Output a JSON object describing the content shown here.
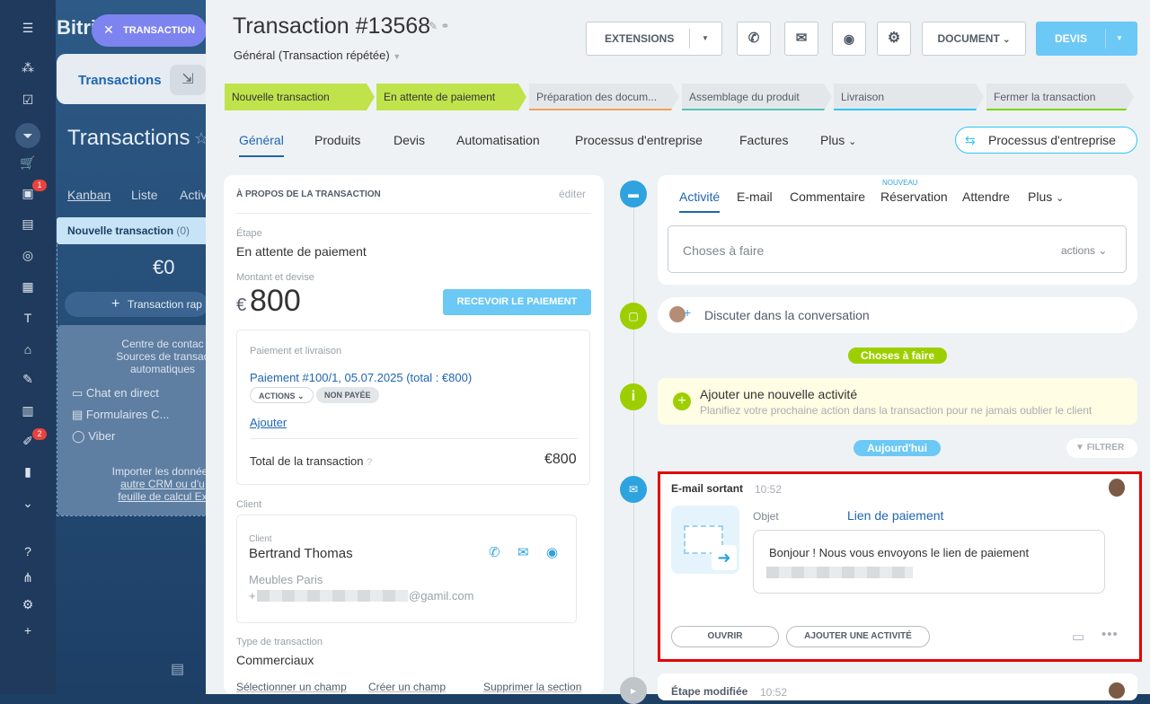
{
  "background": {
    "app_name": "Bitri",
    "tab_label": "Transactions",
    "page_title": "Transactions",
    "views": [
      "Kanban",
      "Liste",
      "Activ"
    ],
    "column_title": "Nouvelle transaction",
    "column_count": "(0)",
    "column_sum": "€0",
    "quick_add": "Transaction rap",
    "contact_center_lines": [
      "Centre de contac",
      "Sources de transac",
      "automatiques"
    ],
    "sources": [
      "Chat en direct",
      "Formulaires C...",
      "Viber"
    ],
    "import_lines": [
      "Importer les données",
      "autre CRM ou d'u",
      "feuille de calcul Ex"
    ],
    "badges": [
      "1",
      "2"
    ]
  },
  "chip": {
    "label": "TRANSACTION"
  },
  "header": {
    "title": "Transaction #13568",
    "subtitle": "Général (Transaction répétée)",
    "extensions": "EXTENSIONS",
    "document": "DOCUMENT",
    "devis": "DEVIS"
  },
  "stages": [
    {
      "label": "Nouvelle transaction",
      "color": "#b6dd44"
    },
    {
      "label": "En attente de paiement",
      "color": "#b6dd44"
    },
    {
      "label": "Préparation des docum...",
      "color": "#f1a05b"
    },
    {
      "label": "Assemblage du produit",
      "color": "#55c3b8"
    },
    {
      "label": "Livraison",
      "color": "#2fc6f6"
    },
    {
      "label": "Fermer la transaction",
      "color": "#7bd500"
    }
  ],
  "tabs": [
    "Général",
    "Produits",
    "Devis",
    "Automatisation",
    "Processus d'entreprise",
    "Factures",
    "Plus"
  ],
  "bp_button": "Processus d'entreprise",
  "about": {
    "section_title": "À PROPOS DE LA TRANSACTION",
    "edit": "éditer",
    "stage_label": "Étape",
    "stage_value": "En attente de paiement",
    "amount_label": "Montant et devise",
    "currency": "€",
    "amount": "800",
    "receive_payment": "RECEVOIR LE PAIEMENT",
    "payment_delivery_label": "Paiement et livraison",
    "payment_link": "Paiement #100/1, 05.07.2025 (total : €800)",
    "actions_pill": "ACTIONS",
    "unpaid_pill": "NON PAYÉE",
    "add": "Ajouter",
    "total_label": "Total de la transaction",
    "total_value": "€800",
    "client_section": "Client",
    "client_label": "Client",
    "client_name": "Bertrand Thomas",
    "company": "Meubles Paris",
    "email_prefix": "+",
    "email_suffix": "@gamil.com",
    "type_label": "Type de transaction",
    "type_value": "Commerciaux",
    "select_field": "Sélectionner un champ",
    "create_field": "Créer un champ",
    "delete_section": "Supprimer la section"
  },
  "activity": {
    "tabs": [
      "Activité",
      "E-mail",
      "Commentaire",
      "Réservation",
      "Attendre",
      "Plus"
    ],
    "new_badge": "NOUVEAU",
    "todo_placeholder": "Choses à faire",
    "actions": "actions",
    "chat_text": "Discuter dans la conversation",
    "todo_sep": "Choses à faire",
    "new_activity_title": "Ajouter une nouvelle activité",
    "new_activity_hint": "Planifiez votre prochaine action dans la transaction pour ne jamais oublier le client",
    "today_sep": "Aujourd'hui",
    "filter": "FILTRER",
    "email_title": "E-mail sortant",
    "email_time": "10:52",
    "subject_label": "Objet",
    "subject_value": "Lien de paiement",
    "email_body": "Bonjour ! Nous vous envoyons le lien de paiement",
    "open_btn": "OUVRIR",
    "add_activity_btn": "AJOUTER UNE ACTIVITÉ",
    "stage_changed": "Étape modifiée",
    "stage_changed_time": "10:52"
  }
}
